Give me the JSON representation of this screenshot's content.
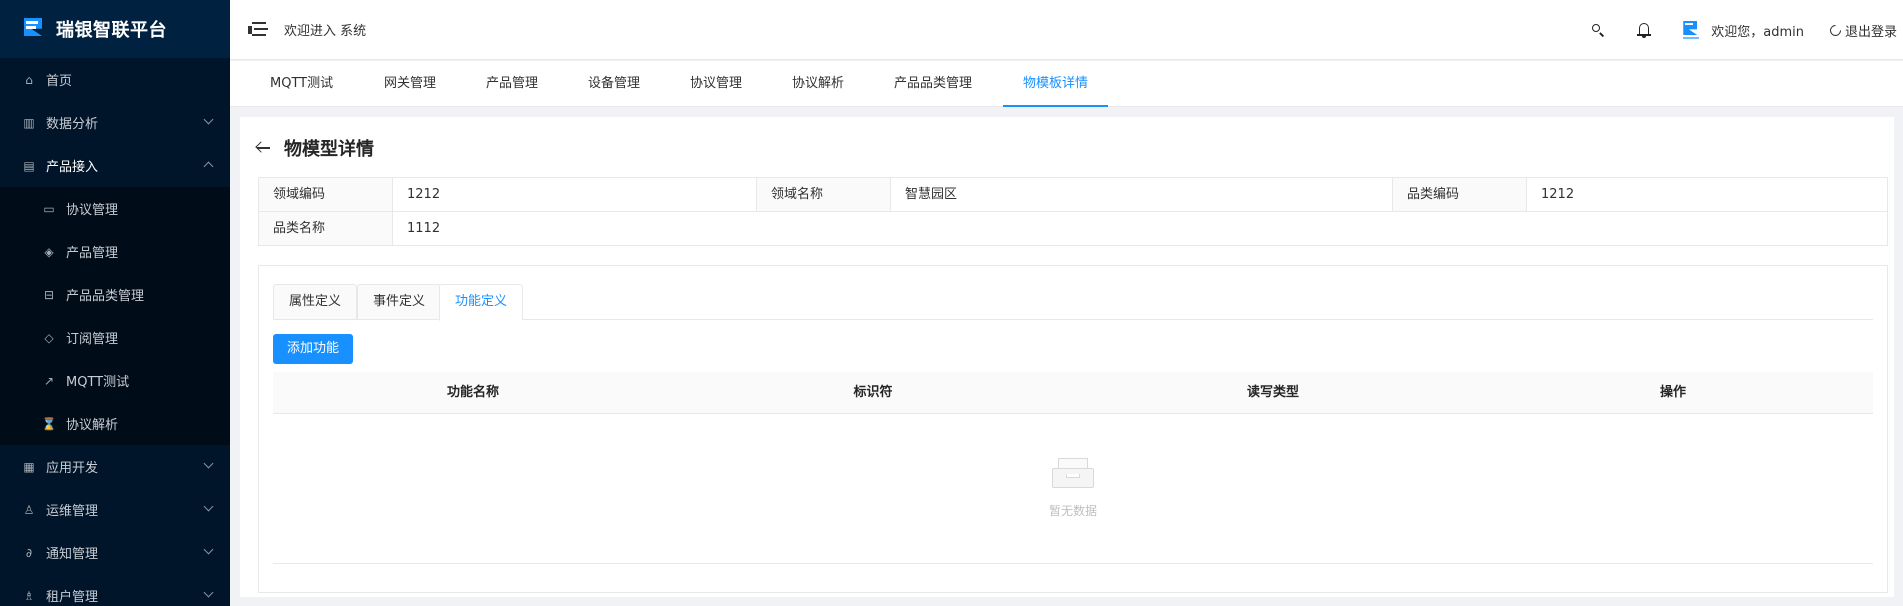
{
  "brand": {
    "title": "瑞银智联平台"
  },
  "sidebar": {
    "items": [
      {
        "label": "首页",
        "icon": "home-icon",
        "has_children": false
      },
      {
        "label": "数据分析",
        "icon": "data-analysis-icon",
        "has_children": true,
        "expanded": false
      },
      {
        "label": "产品接入",
        "icon": "product-access-icon",
        "has_children": true,
        "expanded": true
      },
      {
        "label": "应用开发",
        "icon": "app-dev-icon",
        "has_children": true,
        "expanded": false
      },
      {
        "label": "运维管理",
        "icon": "ops-icon",
        "has_children": true,
        "expanded": false
      },
      {
        "label": "通知管理",
        "icon": "notify-icon",
        "has_children": true,
        "expanded": false
      },
      {
        "label": "租户管理",
        "icon": "tenant-icon",
        "has_children": true,
        "expanded": false
      }
    ],
    "sub_items": [
      {
        "label": "协议管理",
        "icon": "monitor-icon"
      },
      {
        "label": "产品管理",
        "icon": "cube-icon"
      },
      {
        "label": "产品品类管理",
        "icon": "category-icon"
      },
      {
        "label": "订阅管理",
        "icon": "tag-icon"
      },
      {
        "label": "MQTT测试",
        "icon": "rocket-icon"
      },
      {
        "label": "协议解析",
        "icon": "hourglass-icon"
      }
    ]
  },
  "header": {
    "welcome_system": "欢迎进入 系统",
    "welcome_user": "欢迎您，admin",
    "logout": "退出登录"
  },
  "nav_tabs": [
    {
      "label": "MQTT测试",
      "active": false
    },
    {
      "label": "网关管理",
      "active": false
    },
    {
      "label": "产品管理",
      "active": false
    },
    {
      "label": "设备管理",
      "active": false
    },
    {
      "label": "协议管理",
      "active": false
    },
    {
      "label": "协议解析",
      "active": false
    },
    {
      "label": "产品品类管理",
      "active": false
    },
    {
      "label": "物模板详情",
      "active": true
    }
  ],
  "page": {
    "title": "物模型详情",
    "details": {
      "domain_code_label": "领域编码",
      "domain_code_value": "1212",
      "domain_name_label": "领域名称",
      "domain_name_value": "智慧园区",
      "category_code_label": "品类编码",
      "category_code_value": "1212",
      "category_name_label": "品类名称",
      "category_name_value": "1112"
    },
    "tabs": [
      {
        "label": "属性定义",
        "active": false
      },
      {
        "label": "事件定义",
        "active": false
      },
      {
        "label": "功能定义",
        "active": true
      }
    ],
    "add_button": "添加功能",
    "table": {
      "columns": [
        "功能名称",
        "标识符",
        "读写类型",
        "操作"
      ],
      "rows": [],
      "empty_text": "暂无数据"
    }
  },
  "colors": {
    "primary": "#1890ff",
    "sidebar_bg": "#001529",
    "submenu_bg": "#000c17"
  }
}
